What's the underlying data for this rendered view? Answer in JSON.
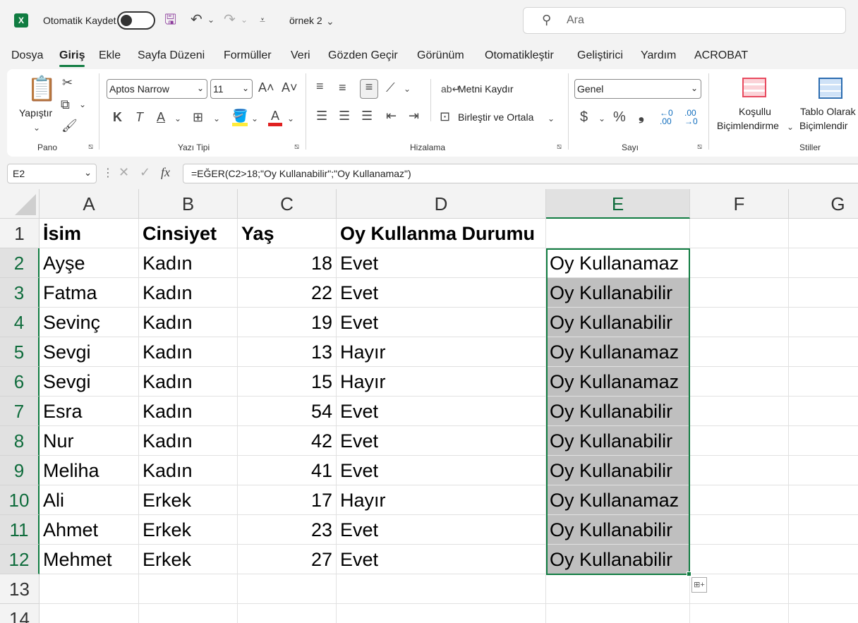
{
  "titlebar": {
    "autosave_label": "Otomatik Kaydet",
    "file_name": "örnek 2",
    "search_placeholder": "Ara"
  },
  "menu": {
    "items": [
      "Dosya",
      "Giriş",
      "Ekle",
      "Sayfa Düzeni",
      "Formüller",
      "Veri",
      "Gözden Geçir",
      "Görünüm",
      "Otomatikleştir",
      "Geliştirici",
      "Yardım",
      "ACROBAT"
    ],
    "active": "Giriş"
  },
  "ribbon": {
    "paste_label": "Yapıştır",
    "pano_label": "Pano",
    "font_name": "Aptos Narrow",
    "font_size": "11",
    "font_group_label": "Yazı Tipi",
    "wrap_text_label": "Metni Kaydır",
    "merge_label": "Birleştir ve Ortala",
    "alignment_label": "Hizalama",
    "number_format": "Genel",
    "number_label": "Sayı",
    "cond_format_line1": "Koşullu",
    "cond_format_line2": "Biçimlendirme",
    "table_format_line1": "Tablo Olarak",
    "table_format_line2": "Biçimlendir",
    "styles_label": "Stiller",
    "bold_glyph": "K",
    "italic_glyph": "T",
    "underline_glyph": "A",
    "fontcolor_glyph": "A",
    "currency_glyph": "$",
    "percent_glyph": "%",
    "comma_glyph": "❟",
    "grow_font_glyph": "A˄",
    "shrink_font_glyph": "A˅"
  },
  "formula_bar": {
    "name_box": "E2",
    "formula": "=EĞER(C2>18;\"Oy Kullanabilir\";\"Oy Kullanamaz\")"
  },
  "sheet": {
    "columns": [
      "A",
      "B",
      "C",
      "D",
      "E",
      "F",
      "G"
    ],
    "row_numbers": [
      "1",
      "2",
      "3",
      "4",
      "5",
      "6",
      "7",
      "8",
      "9",
      "10",
      "11",
      "12",
      "13",
      "14"
    ],
    "headers": [
      "İsim",
      "Cinsiyet",
      "Yaş",
      "Oy Kullanma Durumu",
      ""
    ],
    "rows": [
      [
        "Ayşe",
        "Kadın",
        "18",
        "Evet",
        "Oy Kullanamaz"
      ],
      [
        "Fatma",
        "Kadın",
        "22",
        "Evet",
        "Oy Kullanabilir"
      ],
      [
        "Sevinç",
        "Kadın",
        "19",
        "Evet",
        "Oy Kullanabilir"
      ],
      [
        "Sevgi",
        "Kadın",
        "13",
        "Hayır",
        "Oy Kullanamaz"
      ],
      [
        "Sevgi",
        "Kadın",
        "15",
        "Hayır",
        "Oy Kullanamaz"
      ],
      [
        "Esra",
        "Kadın",
        "54",
        "Evet",
        "Oy Kullanabilir"
      ],
      [
        "Nur",
        "Kadın",
        "42",
        "Evet",
        "Oy Kullanabilir"
      ],
      [
        "Meliha",
        "Kadın",
        "41",
        "Evet",
        "Oy Kullanabilir"
      ],
      [
        "Ali",
        "Erkek",
        "17",
        "Hayır",
        "Oy Kullanamaz"
      ],
      [
        "Ahmet",
        "Erkek",
        "23",
        "Evet",
        "Oy Kullanabilir"
      ],
      [
        "Mehmet",
        "Erkek",
        "27",
        "Evet",
        "Oy Kullanabilir"
      ]
    ],
    "selected_column": "E",
    "selected_range": "E2:E12",
    "accent_color": "#107c41",
    "selection_fill": "#bfbfbf"
  }
}
